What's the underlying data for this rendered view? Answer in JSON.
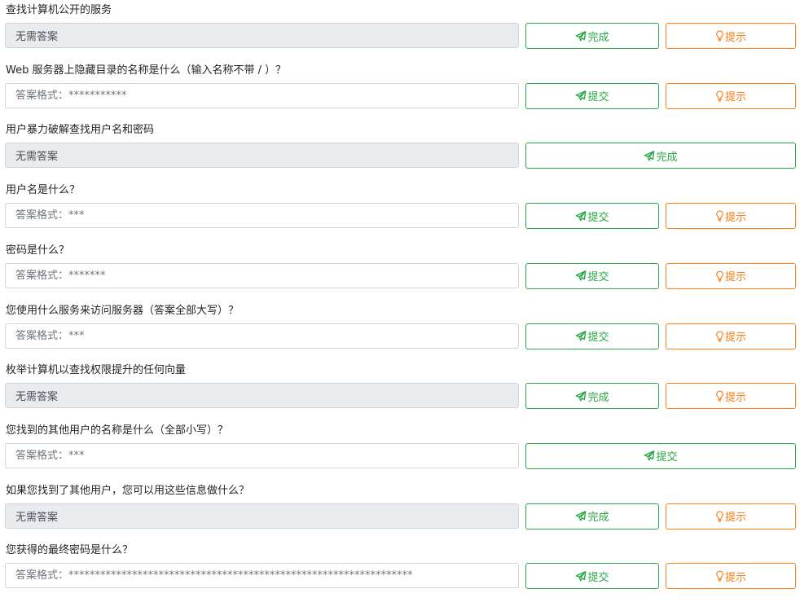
{
  "questions": [
    {
      "text": "查找计算机公开的服务",
      "answered": true,
      "value": "无需答案",
      "placeholder": "",
      "submit_label": "完成",
      "hint_label": "提示",
      "has_hint": true
    },
    {
      "text": "Web 服务器上隐藏目录的名称是什么（输入名称不带 / ）？",
      "answered": false,
      "value": "",
      "placeholder": "答案格式：***********",
      "submit_label": "提交",
      "hint_label": "提示",
      "has_hint": true
    },
    {
      "text": "用户暴力破解查找用户名和密码",
      "answered": true,
      "value": "无需答案",
      "placeholder": "",
      "submit_label": "完成",
      "hint_label": "",
      "has_hint": false
    },
    {
      "text": "用户名是什么？",
      "answered": false,
      "value": "",
      "placeholder": "答案格式：***",
      "submit_label": "提交",
      "hint_label": "提示",
      "has_hint": true
    },
    {
      "text": "密码是什么？",
      "answered": false,
      "value": "",
      "placeholder": "答案格式：*******",
      "submit_label": "提交",
      "hint_label": "提示",
      "has_hint": true
    },
    {
      "text": "您使用什么服务来访问服务器（答案全部大写）？",
      "answered": false,
      "value": "",
      "placeholder": "答案格式：***",
      "submit_label": "提交",
      "hint_label": "提示",
      "has_hint": true
    },
    {
      "text": "枚举计算机以查找权限提升的任何向量",
      "answered": true,
      "value": "无需答案",
      "placeholder": "",
      "submit_label": "完成",
      "hint_label": "提示",
      "has_hint": true
    },
    {
      "text": "您找到的其他用户的名称是什么（全部小写）？",
      "answered": false,
      "value": "",
      "placeholder": "答案格式：***",
      "submit_label": "提交",
      "hint_label": "",
      "has_hint": false
    },
    {
      "text": "如果您找到了其他用户，您可以用这些信息做什么？",
      "answered": true,
      "value": "无需答案",
      "placeholder": "",
      "submit_label": "完成",
      "hint_label": "提示",
      "has_hint": true
    },
    {
      "text": "您获得的最终密码是什么？",
      "answered": false,
      "value": "",
      "placeholder": "答案格式：*****************************************************************",
      "submit_label": "提交",
      "hint_label": "提示",
      "has_hint": true
    }
  ],
  "colors": {
    "success": "#28a745",
    "warning": "#fd7e14",
    "disabled_bg": "#e9ecef",
    "border": "#ced4da"
  },
  "icons": {
    "submit": "paper-plane-icon",
    "hint": "lightbulb-icon"
  }
}
